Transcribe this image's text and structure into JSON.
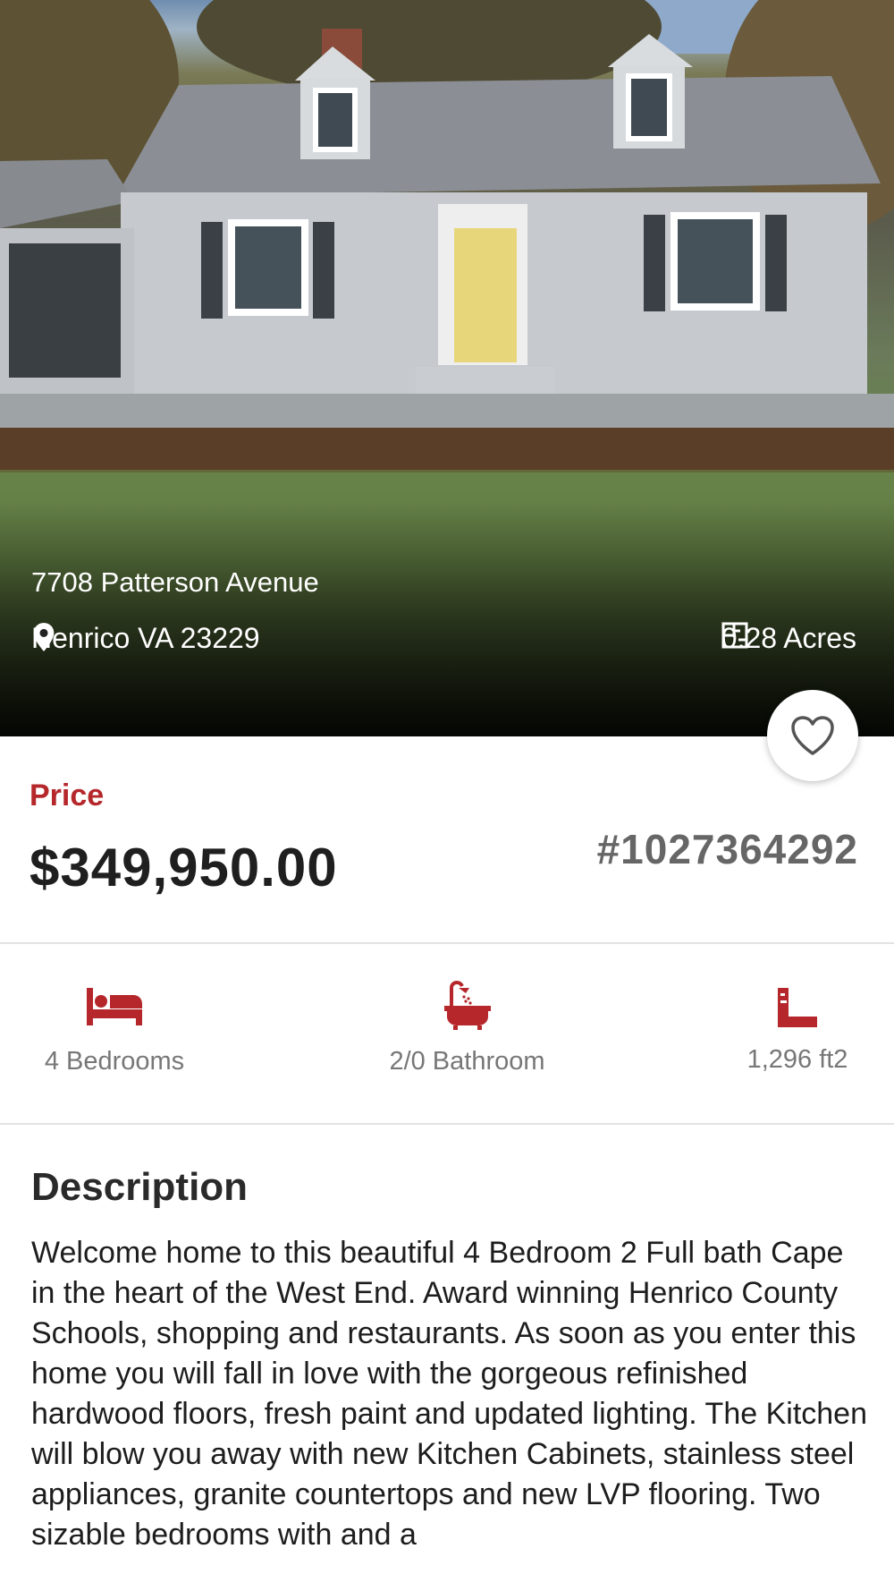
{
  "listing": {
    "address": "7708 Patterson Avenue",
    "city": "Henrico VA 23229",
    "lot_size": "0.28 Acres",
    "price_label": "Price",
    "price": "$349,950.00",
    "mls_id": "#1027364292"
  },
  "features": [
    {
      "icon": "bed-icon",
      "label": "4 Bedrooms"
    },
    {
      "icon": "bathtub-icon",
      "label": "2/0 Bathroom"
    },
    {
      "icon": "ruler-icon",
      "label": "1,296 ft2"
    }
  ],
  "description": {
    "title": "Description",
    "text": "Welcome home to this beautiful 4 Bedroom 2 Full bath Cape in the heart of the West End. Award winning Henrico County Schools, shopping and restaurants. As soon as you enter this home you will fall in love with the gorgeous refinished hardwood floors, fresh paint and updated lighting. The Kitchen will blow you away with new Kitchen Cabinets, stainless steel appliances, granite countertops and new LVP flooring. Two sizable bedrooms with and a"
  },
  "colors": {
    "accent": "#b5272b",
    "price_text": "#1f1f1f",
    "mls_text": "#666666"
  }
}
